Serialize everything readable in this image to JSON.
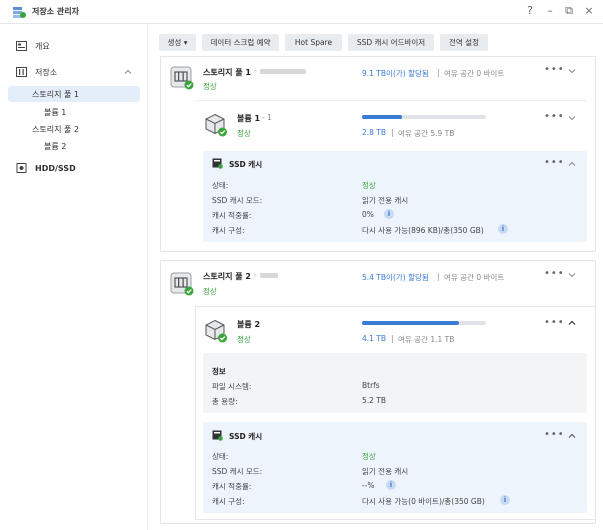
{
  "window": {
    "title": "저장소 관리자",
    "help": "?",
    "minimize": "–",
    "restore": "⧉",
    "close": "×"
  },
  "sidebar": {
    "overview": "개요",
    "storage": "저장소",
    "pool1": "스토리지 풀 1",
    "vol1": "볼륨 1",
    "pool2": "스토리지 풀 2",
    "vol2": "볼륨 2",
    "hdd": "HDD/SSD"
  },
  "toolbar": {
    "create": "생성 ▾",
    "scrub": "데이터 스크럽 예약",
    "hotspare": "Hot Spare",
    "advisor": "SSD 캐시 어드바이저",
    "global": "전역 설정"
  },
  "pool1": {
    "name": "스토리지 풀 1",
    "suffix": "◦",
    "status": "정상",
    "allocated": "9.1 TB이(가) 할당됨",
    "sep": "|",
    "free": "여유 공간 0 바이트",
    "volume": {
      "name": "볼륨 1",
      "suffix": "- 1",
      "status": "정상",
      "progress": 0.32,
      "used": "2.8 TB",
      "sep": "|",
      "free": "여유 공간 5.9 TB"
    },
    "ssd": {
      "title": "SSD 캐시",
      "status_label": "상태:",
      "status_value": "정상",
      "mode_label": "SSD 캐시 모드:",
      "mode_value": "읽기 전용 캐시",
      "hit_label": "캐시 적중률:",
      "hit_value": "0%",
      "config_label": "캐시 구성:",
      "config_value": "다시 사용 가능(896 KB)/총(350 GB)"
    }
  },
  "pool2": {
    "name": "스토리지 풀 2",
    "suffix": "◦",
    "status": "정상",
    "allocated": "5.4 TB이(가) 할당됨",
    "sep": "|",
    "free": "여유 공간 0 바이트",
    "volume": {
      "name": "볼륨 2",
      "status": "정상",
      "progress": 0.78,
      "used": "4.1 TB",
      "sep": "|",
      "free": "여유 공간 1.1 TB"
    },
    "info": {
      "title": "정보",
      "fs_label": "파일 시스템:",
      "fs_value": "Btrfs",
      "cap_label": "총 용량:",
      "cap_value": "5.2 TB"
    },
    "ssd": {
      "title": "SSD 캐시",
      "status_label": "상태:",
      "status_value": "정상",
      "mode_label": "SSD 캐시 모드:",
      "mode_value": "읽기 전용 캐시",
      "hit_label": "캐시 적중률:",
      "hit_value": "--%",
      "config_label": "캐시 구성:",
      "config_value": "다시 사용 가능(0 바이트)/총(350 GB)"
    }
  },
  "icons": {
    "more": "•••",
    "info": "i"
  },
  "colors": {
    "accent": "#3a7bd5",
    "ok": "#3aa33a",
    "active_nav": "#e4eefb",
    "ssd_bg": "#eef4fc"
  }
}
